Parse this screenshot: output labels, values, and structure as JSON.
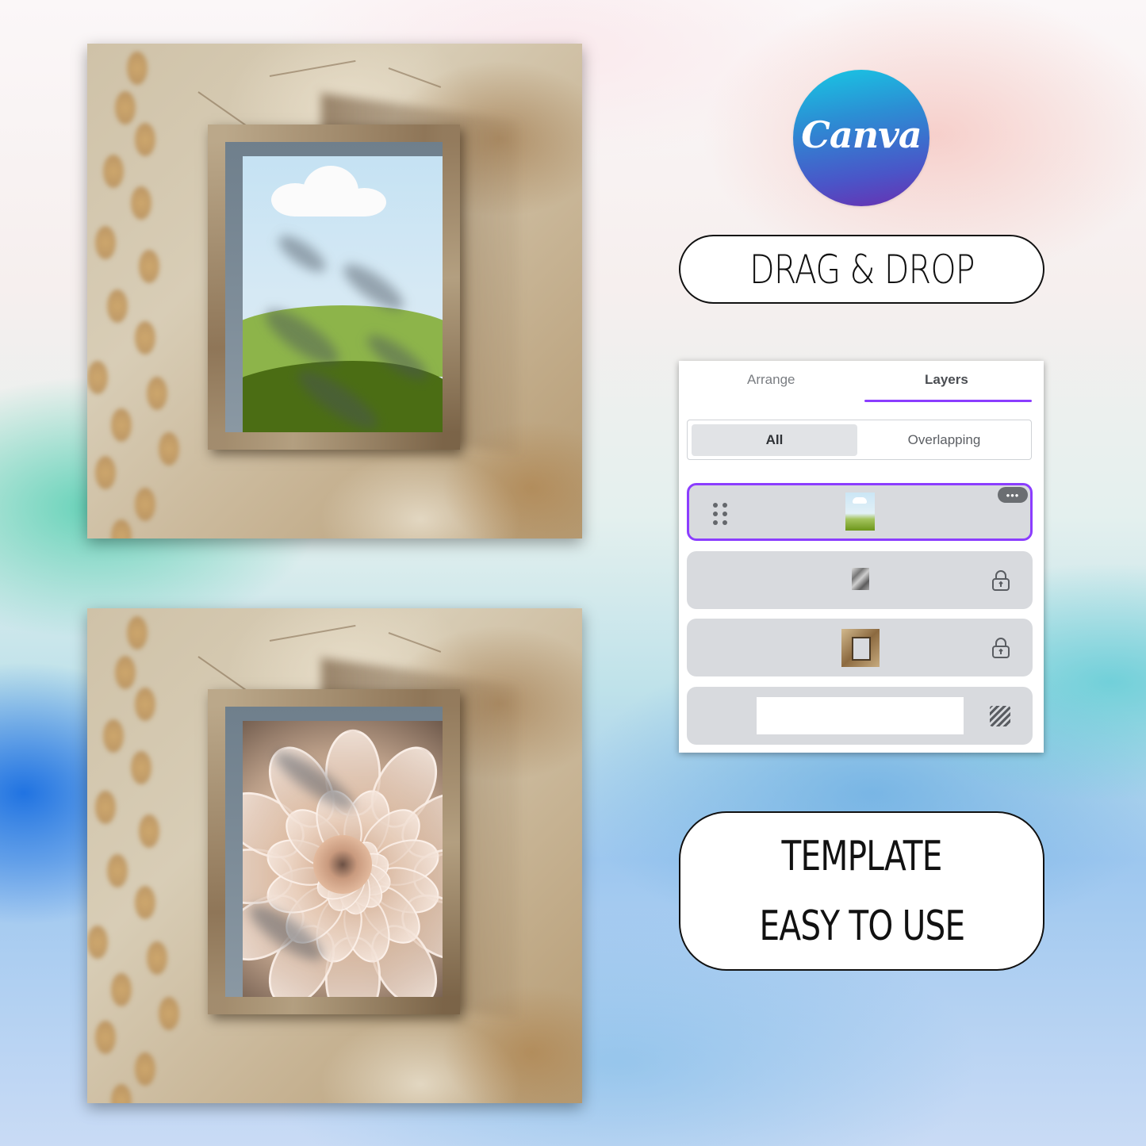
{
  "brand": {
    "logo_text": "Canva",
    "logo_gradient": [
      "#18c8e4",
      "#4a55c8",
      "#6a2fb0"
    ]
  },
  "labels": {
    "drag_drop": "DRAG & DROP",
    "template_line1": "TEMPLATE",
    "template_line2": "EASY TO USE"
  },
  "mockups": [
    {
      "name": "landscape-frame-mockup",
      "artwork": "cloud and green hills landscape"
    },
    {
      "name": "dahlia-frame-mockup",
      "artwork": "peach dahlia flower close-up"
    }
  ],
  "layers_panel": {
    "tabs": [
      {
        "label": "Arrange",
        "active": false
      },
      {
        "label": "Layers",
        "active": true
      }
    ],
    "filter": [
      {
        "label": "All",
        "active": true
      },
      {
        "label": "Overlapping",
        "active": false
      }
    ],
    "more_label": "•••",
    "accent": "#8b3dff",
    "rows": [
      {
        "thumbnail": "landscape-artwork",
        "selected": true,
        "icon": "drag-handle-icon",
        "action": "more-options"
      },
      {
        "thumbnail": "leaf-shadow-overlay",
        "selected": false,
        "icon": "lock-icon"
      },
      {
        "thumbnail": "wooden-frame-photo",
        "selected": false,
        "icon": "lock-icon"
      },
      {
        "thumbnail": "white-background",
        "selected": false,
        "icon": "transparency-icon"
      }
    ]
  }
}
